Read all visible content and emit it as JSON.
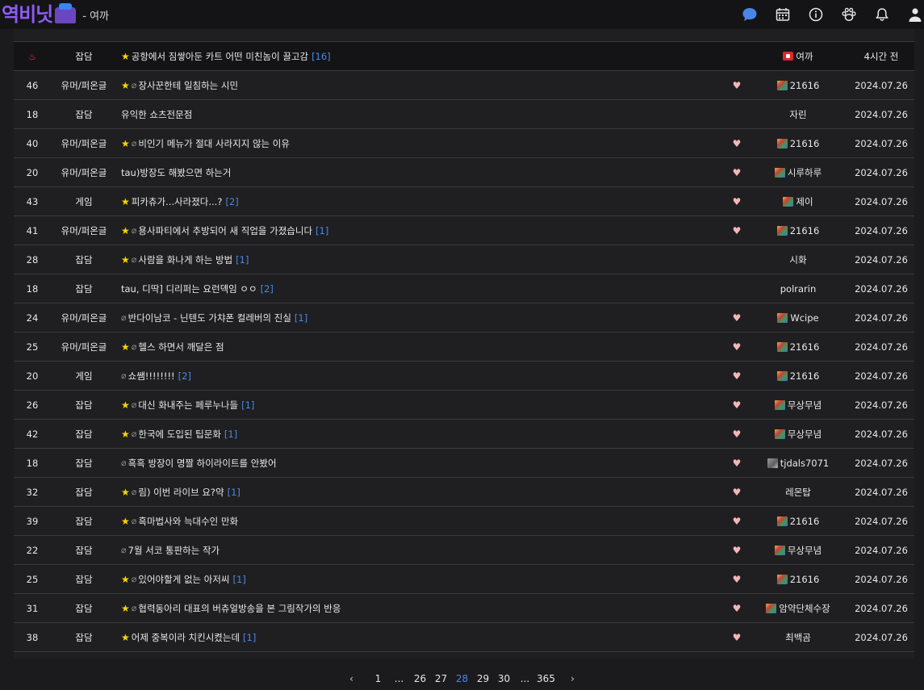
{
  "brand": {
    "logo_text": "역비닛",
    "board_name": "- 여까"
  },
  "top_icons": [
    "chat-bubble-icon",
    "calendar-icon",
    "info-icon",
    "paw-icon",
    "bell-icon",
    "user-icon"
  ],
  "colors": {
    "accent": "#4a86e8",
    "star": "#ffd400",
    "logo": "#8d5cf6",
    "hot": "#ff3b3b"
  },
  "hot_row": {
    "num": "",
    "category": "잡담",
    "title": "공항에서 짐쌓아둔 카트 어떤 미친놈이 끌고감",
    "comments": "[16]",
    "author": "여까",
    "date": "4시간 전"
  },
  "rows": [
    {
      "num": "46",
      "category": "유머/퍼온글",
      "star": true,
      "clip": true,
      "title": "장사꾼한테 일침하는 시민",
      "comments": "",
      "heart": true,
      "level": "color",
      "author": "21616",
      "date": "2024.07.26"
    },
    {
      "num": "18",
      "category": "잡담",
      "star": false,
      "clip": false,
      "title": "유익한 쇼츠전문점",
      "comments": "",
      "heart": false,
      "level": "",
      "author": "자린",
      "date": "2024.07.26"
    },
    {
      "num": "40",
      "category": "유머/퍼온글",
      "star": true,
      "clip": true,
      "title": "비인기 메뉴가 절대 사라지지 않는 이유",
      "comments": "",
      "heart": true,
      "level": "color",
      "author": "21616",
      "date": "2024.07.26"
    },
    {
      "num": "20",
      "category": "유머/퍼온글",
      "star": false,
      "clip": false,
      "title": "tau)방장도 해봤으면 하는거",
      "comments": "",
      "heart": true,
      "level": "color",
      "author": "시루하루",
      "date": "2024.07.26"
    },
    {
      "num": "43",
      "category": "게임",
      "star": true,
      "clip": false,
      "title": "피카츄가...사라졌다...?",
      "comments": "[2]",
      "heart": true,
      "level": "color",
      "author": "제이",
      "date": "2024.07.26"
    },
    {
      "num": "41",
      "category": "유머/퍼온글",
      "star": true,
      "clip": true,
      "title": "용사파티에서 추방되어 새 직업을 가졌습니다",
      "comments": "[1]",
      "heart": true,
      "level": "color",
      "author": "21616",
      "date": "2024.07.26"
    },
    {
      "num": "28",
      "category": "잡담",
      "star": true,
      "clip": true,
      "title": "사람을 화나게 하는 방법",
      "comments": "[1]",
      "heart": false,
      "level": "",
      "author": "시화",
      "date": "2024.07.26"
    },
    {
      "num": "18",
      "category": "잡담",
      "star": false,
      "clip": false,
      "title": "tau, 디딱] 디리퍼는 요런뎩임 ㅇㅇ",
      "comments": "[2]",
      "heart": false,
      "level": "",
      "author": "polrarin",
      "date": "2024.07.26"
    },
    {
      "num": "24",
      "category": "유머/퍼온글",
      "star": false,
      "clip": true,
      "title": "반다이남코 - 닌텐도 가챠폰 컬레버의 진실",
      "comments": "[1]",
      "heart": true,
      "level": "color",
      "author": "Wcipe",
      "date": "2024.07.26"
    },
    {
      "num": "25",
      "category": "유머/퍼온글",
      "star": true,
      "clip": true,
      "title": "헬스 하면서 깨달은 점",
      "comments": "",
      "heart": true,
      "level": "color",
      "author": "21616",
      "date": "2024.07.26"
    },
    {
      "num": "20",
      "category": "게임",
      "star": false,
      "clip": true,
      "title": "쇼쌤!!!!!!!!",
      "comments": "[2]",
      "heart": true,
      "level": "color",
      "author": "21616",
      "date": "2024.07.26"
    },
    {
      "num": "26",
      "category": "잡담",
      "star": true,
      "clip": true,
      "title": "대신 화내주는 페루누나들",
      "comments": "[1]",
      "heart": true,
      "level": "color",
      "author": "무상무념",
      "date": "2024.07.26"
    },
    {
      "num": "42",
      "category": "잡담",
      "star": true,
      "clip": true,
      "title": "한국에 도입된 팁문화",
      "comments": "[1]",
      "heart": true,
      "level": "color",
      "author": "무상무념",
      "date": "2024.07.26"
    },
    {
      "num": "18",
      "category": "잡담",
      "star": false,
      "clip": true,
      "title": "흑흑 방장이 명짤 하이라이트를 안봤어",
      "comments": "",
      "heart": true,
      "level": "gray",
      "author": "tjdals7071",
      "date": "2024.07.26"
    },
    {
      "num": "32",
      "category": "잡담",
      "star": true,
      "clip": true,
      "title": "림) 이번 라이브 요?약",
      "comments": "[1]",
      "heart": true,
      "level": "",
      "author": "레몬탑",
      "date": "2024.07.26"
    },
    {
      "num": "39",
      "category": "잡담",
      "star": true,
      "clip": true,
      "title": "흑마법사와 늑대수인 만화",
      "comments": "",
      "heart": true,
      "level": "color",
      "author": "21616",
      "date": "2024.07.26"
    },
    {
      "num": "22",
      "category": "잡담",
      "star": false,
      "clip": true,
      "title": "7월 서코 통판하는 작가",
      "comments": "",
      "heart": true,
      "level": "color",
      "author": "무상무념",
      "date": "2024.07.26"
    },
    {
      "num": "25",
      "category": "잡담",
      "star": true,
      "clip": true,
      "title": "있어야할게 없는 아저씨",
      "comments": "[1]",
      "heart": true,
      "level": "color",
      "author": "21616",
      "date": "2024.07.26"
    },
    {
      "num": "31",
      "category": "잡담",
      "star": true,
      "clip": true,
      "title": "협력동아리 대표의 버츄얼방송을 본 그림작가의 반응",
      "comments": "",
      "heart": true,
      "level": "color",
      "author": "암약단체수장",
      "date": "2024.07.26"
    },
    {
      "num": "38",
      "category": "잡담",
      "star": true,
      "clip": false,
      "title": "어제 중복이라 치킨시켰는데",
      "comments": "[1]",
      "heart": true,
      "level": "",
      "author": "최백곰",
      "date": "2024.07.26"
    }
  ],
  "pagination": {
    "prev": "‹",
    "next": "›",
    "pages": [
      "1",
      "...",
      "26",
      "27",
      "28",
      "29",
      "30",
      "...",
      "365"
    ],
    "current": "28"
  },
  "glyphs": {
    "star": "★",
    "clip": "🔗",
    "heart": "♥",
    "fire": "♨"
  }
}
